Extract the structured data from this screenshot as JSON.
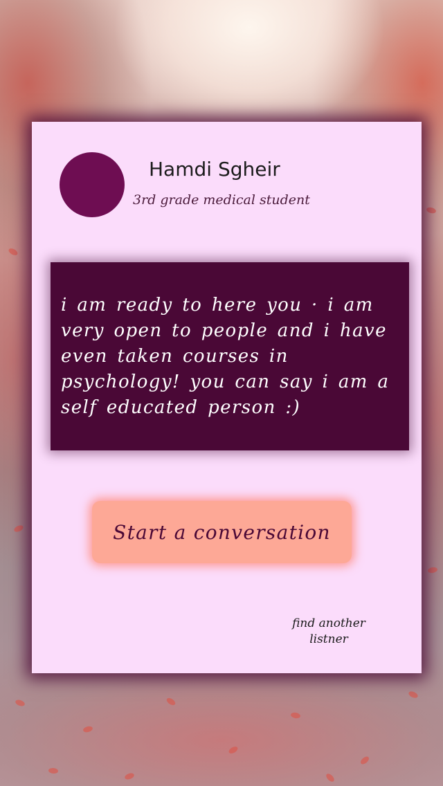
{
  "profile": {
    "name": "Hamdi Sgheir",
    "role": "3rd grade medical student"
  },
  "message": {
    "text": "i am ready to here you · i am very open to people and i have even taken courses in psychology! you can say i am a self educated person :)"
  },
  "actions": {
    "start_label": "Start a conversation",
    "find_another_label": "find another listner"
  },
  "colors": {
    "card_background": "#fbdcfb",
    "avatar": "#6e0d52",
    "message_background": "#4a0836",
    "button_background": "#fda896"
  }
}
